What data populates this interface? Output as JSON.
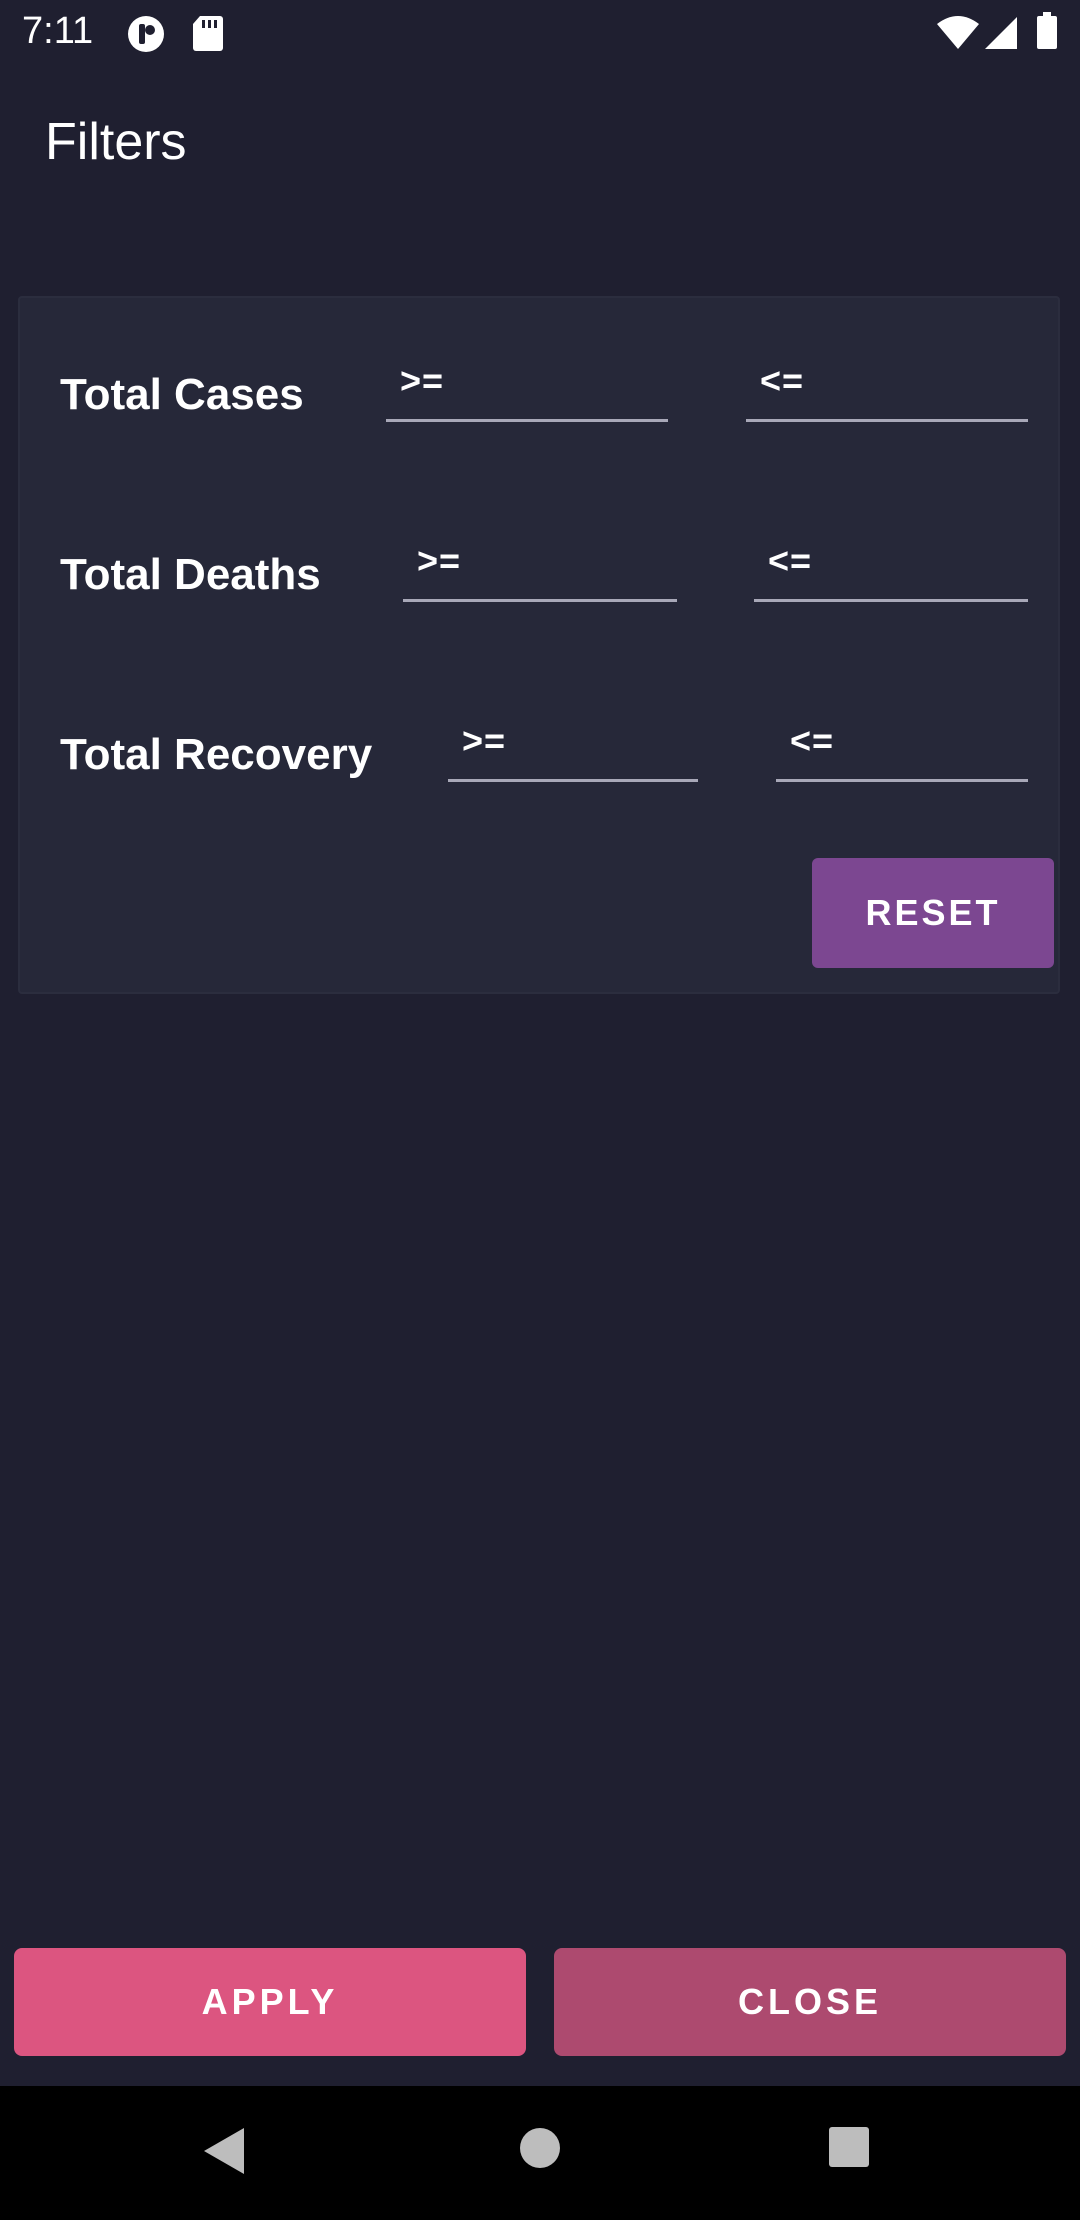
{
  "status_bar": {
    "time": "7:11",
    "icons": [
      "app-notification-icon",
      "sd-card-icon",
      "wifi-icon",
      "signal-icon",
      "battery-icon"
    ]
  },
  "page": {
    "title": "Filters"
  },
  "filters": {
    "rows": [
      {
        "label": "Total Cases",
        "min_placeholder": ">=",
        "max_placeholder": "<="
      },
      {
        "label": "Total Deaths",
        "min_placeholder": ">=",
        "max_placeholder": "<="
      },
      {
        "label": "Total Recovery",
        "min_placeholder": ">=",
        "max_placeholder": "<="
      }
    ],
    "reset_label": "RESET"
  },
  "actions": {
    "apply_label": "APPLY",
    "close_label": "CLOSE"
  },
  "nav_bar": {
    "icons": [
      "back-icon",
      "home-icon",
      "recents-icon"
    ]
  },
  "colors": {
    "background": "#1f1f30",
    "card": "#262839",
    "reset": "#7c4791",
    "apply": "#dc5580",
    "close": "#ad4a6f"
  }
}
